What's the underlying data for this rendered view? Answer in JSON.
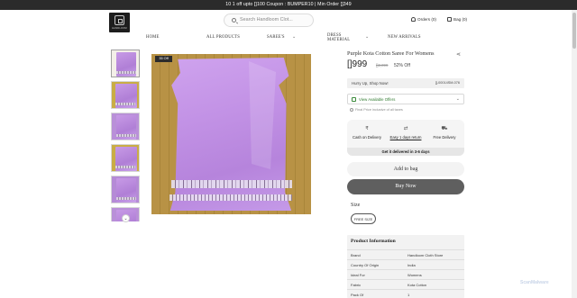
{
  "announcement": "10 1 off upto []100 Coupon : BUMPER10 | Min Order []349",
  "logo": {
    "text": "HANDLOOM"
  },
  "search": {
    "placeholder": "Search Handloom Clot..."
  },
  "header": {
    "orders_label": "Orders (0)",
    "bag_label": "Bag (0)"
  },
  "nav": {
    "items": [
      {
        "label": "HOME"
      },
      {
        "label": "ALL PRODUCTS"
      },
      {
        "label": "SAREE'S"
      },
      {
        "label": "DRESS\nMATERIAL"
      },
      {
        "label": "NEW ARRIVALS"
      }
    ]
  },
  "gallery": {
    "badge": "35 Off"
  },
  "product": {
    "title": "Purple Kota Cotton Saree For Womens",
    "price": "[]999",
    "mrp": "[]2,099",
    "discount": "52% Off",
    "stock_note": "Hurry Up, Shop Now!",
    "sku": "[]-00014SM-076",
    "offers_label": "View Available Offers",
    "tax_note": "Final Price inclusive of all taxes",
    "benefits": [
      {
        "icon": "rupee-icon",
        "label": "Cash on Delivery"
      },
      {
        "icon": "return-icon",
        "label": "Easy 1 days return"
      },
      {
        "icon": "truck-icon",
        "label": "Free Delivery"
      }
    ],
    "delivery": "Get it delivered in 3-6 days",
    "add_to_bag": "Add to bag",
    "buy_now": "Buy Now",
    "size_label": "Size",
    "size_value": "FREE SIZE"
  },
  "product_info": {
    "heading": "Product Information",
    "rows": [
      {
        "key": "Brand",
        "value": "Handloom Cloth Store"
      },
      {
        "key": "Country Of Origin",
        "value": "India"
      },
      {
        "key": "Ideal For",
        "value": "Womens"
      },
      {
        "key": "Fabric",
        "value": "Kota Cotton"
      },
      {
        "key": "Pack Of",
        "value": "1"
      }
    ]
  },
  "watermark": "ScanMalware"
}
